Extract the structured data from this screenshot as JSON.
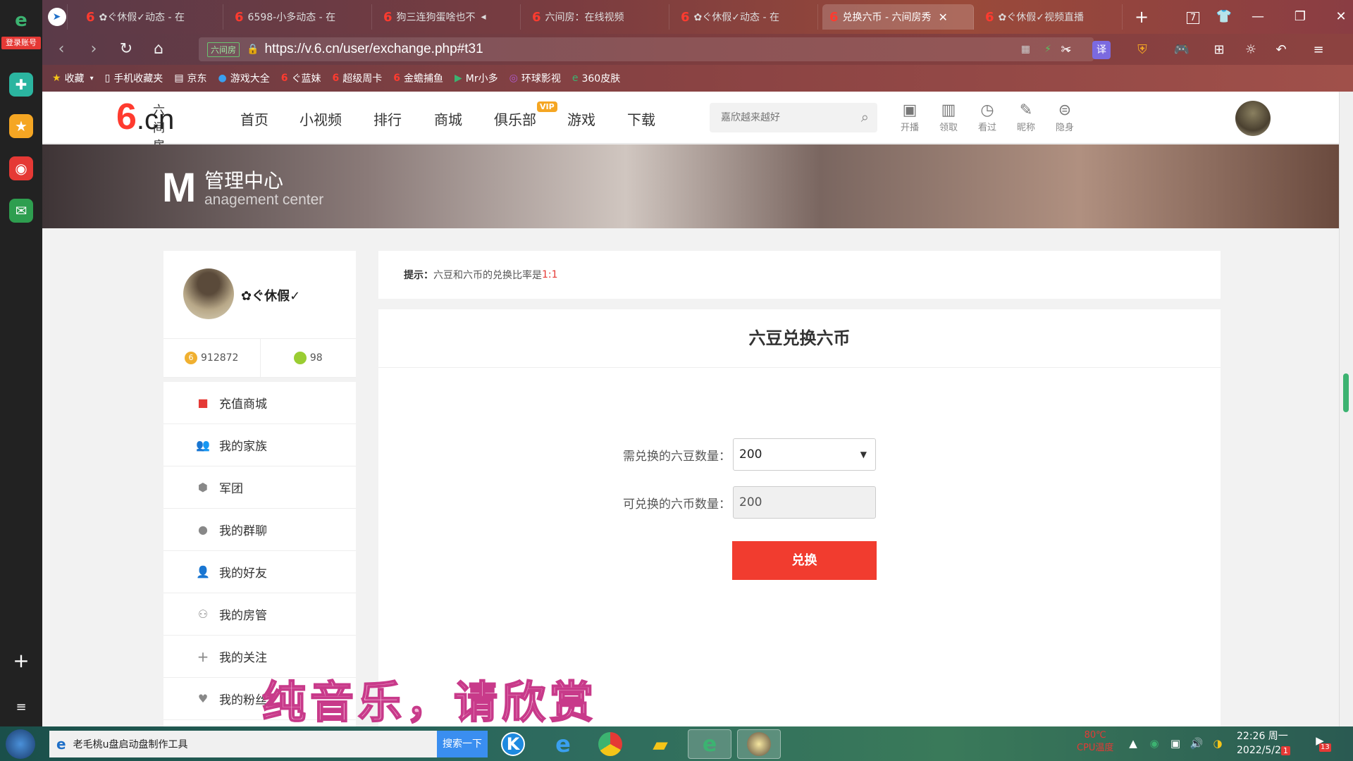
{
  "browser": {
    "login_label": "登录账号",
    "tabs": [
      {
        "label": "✿ぐ休假✓动态 - 在"
      },
      {
        "label": "6598-小多动态 - 在"
      },
      {
        "label": "狗三连狗蛋啥也不"
      },
      {
        "label": "六间房：在线视频"
      },
      {
        "label": "✿ぐ休假✓动态 - 在"
      },
      {
        "label": "兑换六币 - 六间房秀"
      },
      {
        "label": "✿ぐ休假✓视频直播"
      }
    ],
    "tab_count_badge": "7",
    "site_tag": "六间房",
    "url": "https://v.6.cn/user/exchange.php#t31",
    "bookmarks": [
      {
        "label": "收藏"
      },
      {
        "label": "手机收藏夹"
      },
      {
        "label": "京东"
      },
      {
        "label": "游戏大全"
      },
      {
        "label": "ぐ蓝妹"
      },
      {
        "label": "超级周卡"
      },
      {
        "label": "金蟾捕鱼"
      },
      {
        "label": "Mr小多"
      },
      {
        "label": "环球影视"
      },
      {
        "label": "360皮肤"
      }
    ]
  },
  "site": {
    "logo_six": "6",
    "logo_cn": ".cn",
    "logo_name": "六间房",
    "nav": [
      {
        "label": "首页"
      },
      {
        "label": "小视频"
      },
      {
        "label": "排行"
      },
      {
        "label": "商城"
      },
      {
        "label": "俱乐部"
      },
      {
        "label": "游戏"
      },
      {
        "label": "下载"
      }
    ],
    "vip_badge": "VIP",
    "search_placeholder": "嘉欣越来越好",
    "header_tools": [
      {
        "label": "开播"
      },
      {
        "label": "领取"
      },
      {
        "label": "看过"
      },
      {
        "label": "昵称"
      },
      {
        "label": "隐身"
      }
    ]
  },
  "banner": {
    "big_letter": "M",
    "title": "管理中心",
    "subtitle": "anagement center"
  },
  "profile": {
    "name": "✿ぐ休假✓",
    "coins": "912872",
    "beans": "98",
    "menu": [
      {
        "label": "充值商城"
      },
      {
        "label": "我的家族"
      },
      {
        "label": "军团"
      },
      {
        "label": "我的群聊"
      },
      {
        "label": "我的好友"
      },
      {
        "label": "我的房管"
      },
      {
        "label": "我的关注"
      },
      {
        "label": "我的粉丝"
      }
    ]
  },
  "tip": {
    "prefix": "提示：",
    "text": "六豆和六币的兑换比率是",
    "ratio": "1:1"
  },
  "exchange": {
    "title": "六豆兑换六币",
    "bean_label": "需兑换的六豆数量：",
    "bean_value": "200",
    "coin_label": "可兑换的六币数量：",
    "coin_value": "200",
    "button_label": "兑换"
  },
  "overlay_subtitle": "纯音乐，请欣赏",
  "taskbar": {
    "app_title": "老毛桃u盘启动盘制作工具",
    "search_label": "搜索一下",
    "temp": "80℃",
    "temp_label": "CPU温度",
    "time": "22:26 周一",
    "date": "2022/5/2",
    "date_badge": "1",
    "notify_count": "13"
  }
}
